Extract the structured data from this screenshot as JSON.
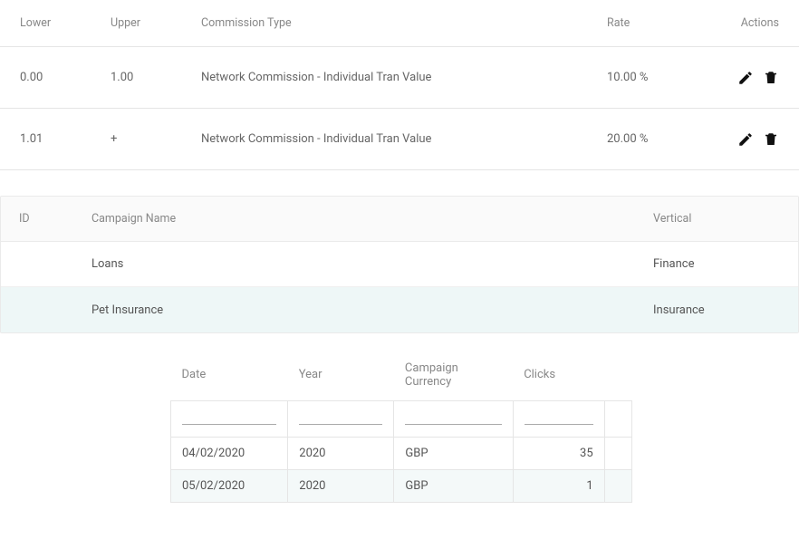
{
  "commission": {
    "headers": {
      "lower": "Lower",
      "upper": "Upper",
      "type": "Commission Type",
      "rate": "Rate",
      "actions": "Actions"
    },
    "rows": [
      {
        "lower": "0.00",
        "upper": "1.00",
        "type": "Network Commission - Individual Tran Value",
        "rate": "10.00 %"
      },
      {
        "lower": "1.01",
        "upper": "+",
        "type": "Network Commission - Individual Tran Value",
        "rate": "20.00 %"
      }
    ]
  },
  "campaign": {
    "headers": {
      "id": "ID",
      "name": "Campaign Name",
      "vertical": "Vertical"
    },
    "rows": [
      {
        "id": "",
        "name": "Loans",
        "vertical": "Finance",
        "highlight": false
      },
      {
        "id": "",
        "name": "Pet Insurance",
        "vertical": "Insurance",
        "highlight": true
      }
    ]
  },
  "report": {
    "headers": {
      "date": "Date",
      "year": "Year",
      "currency": "Campaign Currency",
      "clicks": "Clicks"
    },
    "rows": [
      {
        "date": "04/02/2020",
        "year": "2020",
        "currency": "GBP",
        "clicks": "35"
      },
      {
        "date": "05/02/2020",
        "year": "2020",
        "currency": "GBP",
        "clicks": "1"
      }
    ]
  }
}
